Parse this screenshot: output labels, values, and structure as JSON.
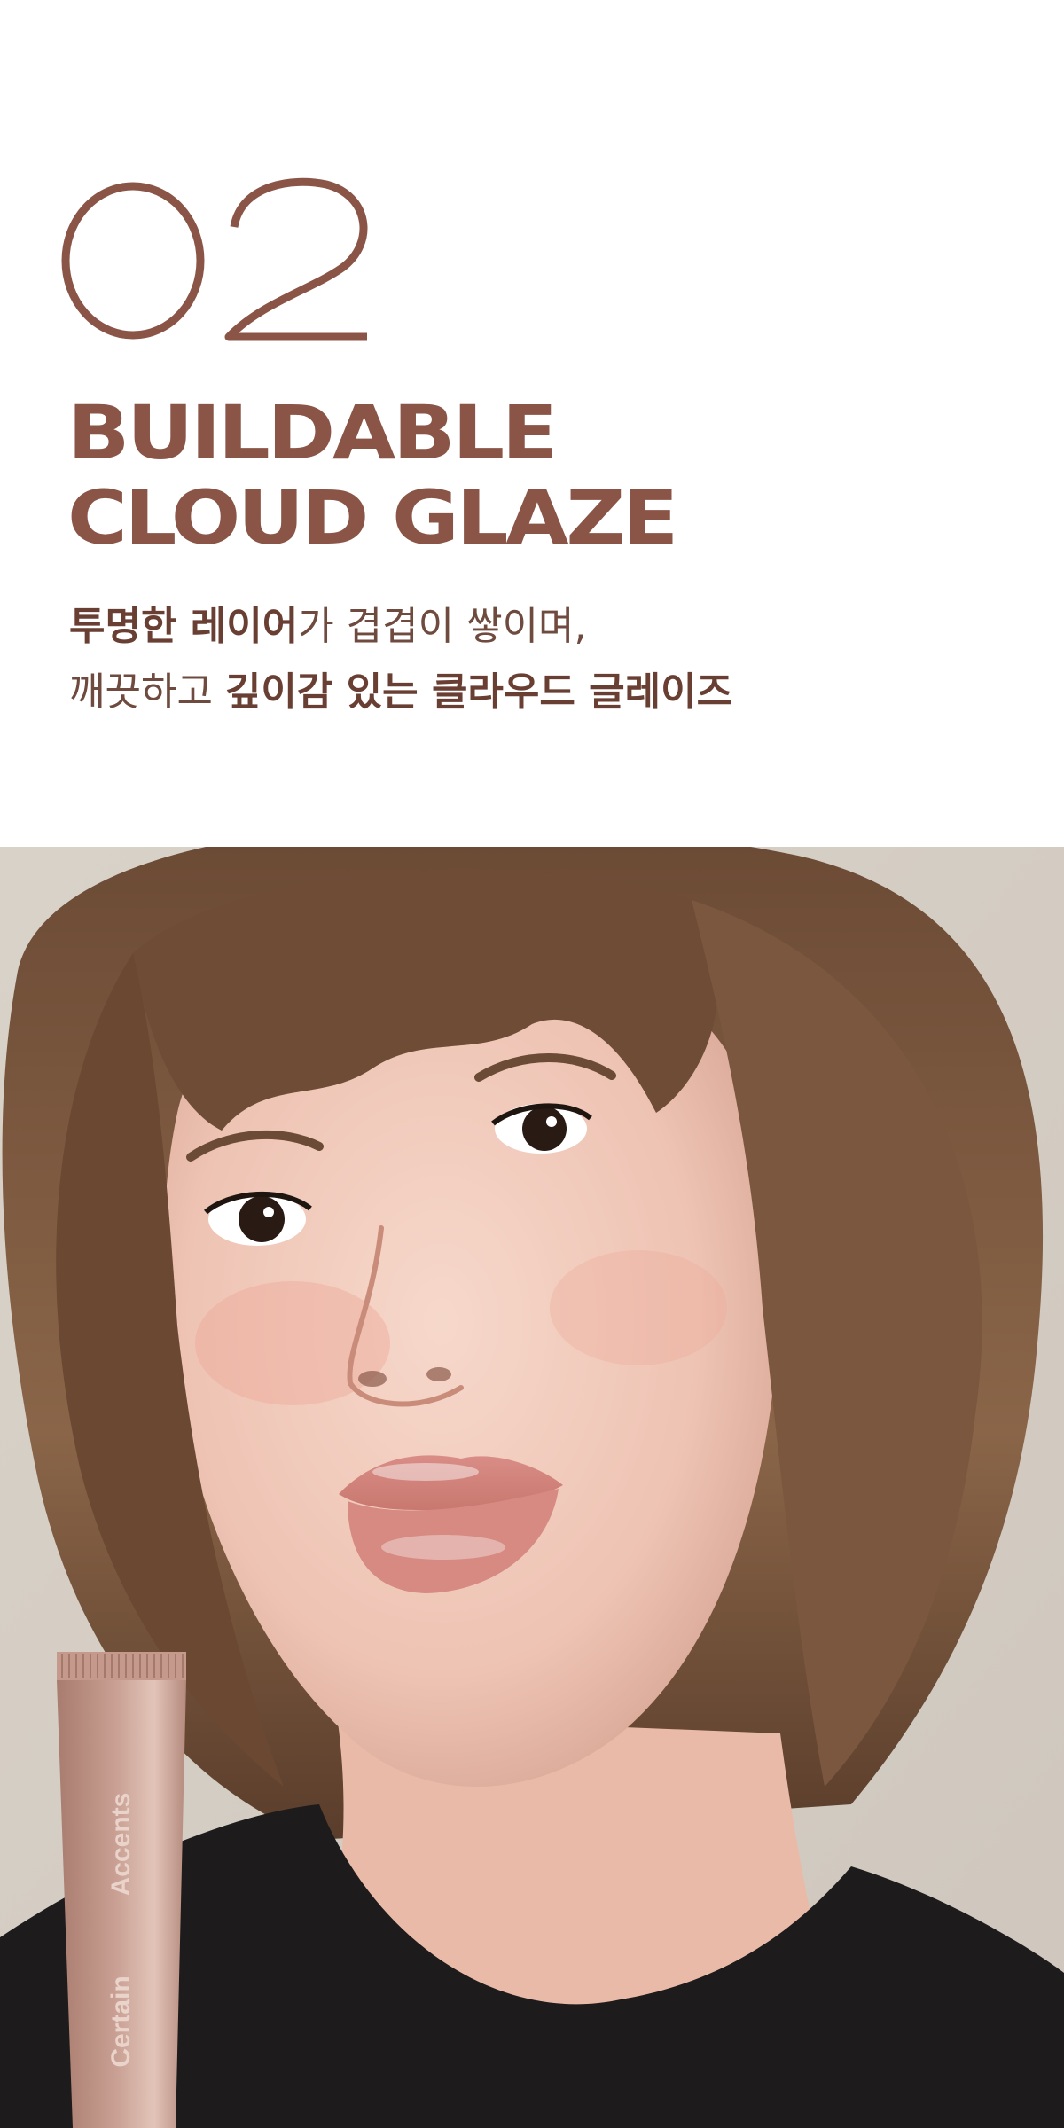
{
  "section": {
    "number": "02"
  },
  "headline": {
    "line1": "BUILDABLE",
    "line2": "CLOUD GLAZE"
  },
  "body": {
    "line1": [
      {
        "text": "투명한 레이어",
        "bold": true
      },
      {
        "text": "가 겹겹이 쌓이며,",
        "bold": false
      }
    ],
    "line2": [
      {
        "text": "깨끗하고 ",
        "bold": false
      },
      {
        "text": "깊이감 있는 클라우드 글레이즈",
        "bold": true
      }
    ]
  },
  "product": {
    "brand_top": "Accents",
    "brand_bottom": "Certain"
  },
  "colors": {
    "accent": "#8a5546",
    "body_text": "#6f4a3e",
    "tube_body": "#b98f82",
    "tube_cap": "#c59a8c"
  },
  "images": {
    "model_photo": "portrait-of-model-with-glossy-lips",
    "product_tube": "lip-glaze-tube"
  }
}
